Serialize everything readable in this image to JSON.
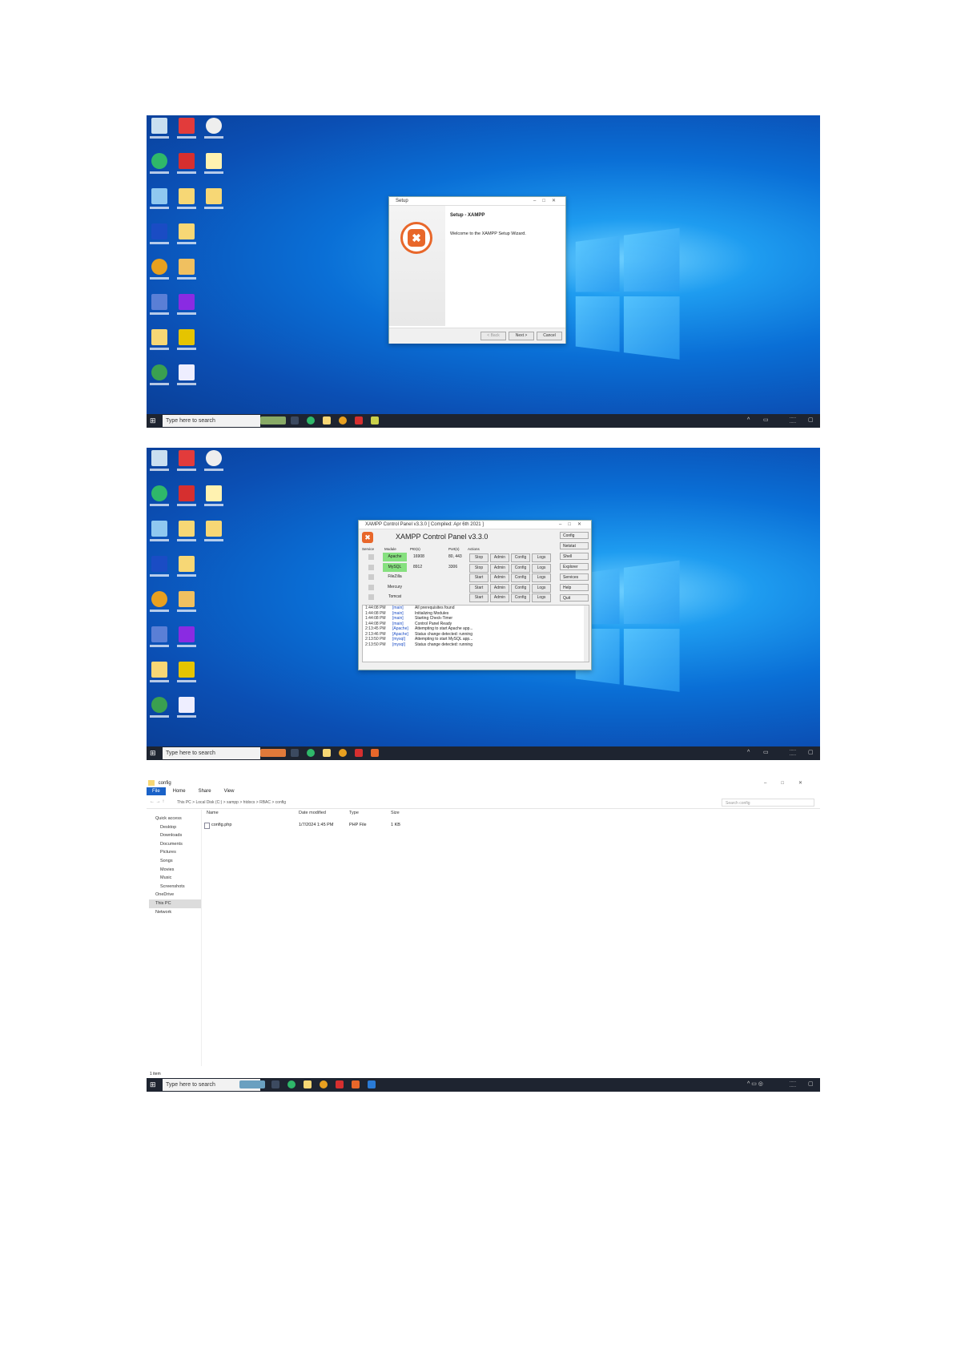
{
  "taskbar": {
    "search_placeholder": "Type here to search"
  },
  "shot1": {
    "setup": {
      "title": "Setup",
      "heading": "Setup - XAMPP",
      "welcome": "Welcome to the XAMPP Setup Wizard.",
      "buttons": {
        "back": "< Back",
        "next": "Next >",
        "cancel": "Cancel"
      }
    }
  },
  "shot2": {
    "panel": {
      "title": "XAMPP Control Panel v3.3.0  [ Compiled: Apr 6th 2021 ]",
      "heading": "XAMPP Control Panel v3.3.0",
      "col_headers": {
        "service": "Service",
        "module": "Module",
        "pid": "PID(s)",
        "port": "Port(s)",
        "actions": "Actions"
      },
      "modules": [
        {
          "name": "Apache",
          "pid": "16908",
          "port": "80, 443",
          "action1": "Stop",
          "status": "#86e07f"
        },
        {
          "name": "MySQL",
          "pid": "8912",
          "port": "3306",
          "action1": "Stop",
          "status": "#86e07f"
        },
        {
          "name": "FileZilla",
          "pid": "",
          "port": "",
          "action1": "Start",
          "status": ""
        },
        {
          "name": "Mercury",
          "pid": "",
          "port": "",
          "action1": "Start",
          "status": ""
        },
        {
          "name": "Tomcat",
          "pid": "",
          "port": "",
          "action1": "Start",
          "status": ""
        }
      ],
      "action_labels": {
        "admin": "Admin",
        "config": "Config",
        "logs": "Logs"
      },
      "side_buttons": [
        "Config",
        "Netstat",
        "Shell",
        "Explorer",
        "Services",
        "Help",
        "Quit"
      ],
      "log": [
        {
          "time": "1:44:08 PM",
          "module": "[main]",
          "msg": "All prerequisites found"
        },
        {
          "time": "1:44:08 PM",
          "module": "[main]",
          "msg": "Initializing Modules"
        },
        {
          "time": "1:44:08 PM",
          "module": "[main]",
          "msg": "Starting Check-Timer"
        },
        {
          "time": "1:44:08 PM",
          "module": "[main]",
          "msg": "Control Panel Ready"
        },
        {
          "time": "2:13:45 PM",
          "module": "[Apache]",
          "msg": "Attempting to start Apache app..."
        },
        {
          "time": "2:13:46 PM",
          "module": "[Apache]",
          "msg": "Status change detected: running"
        },
        {
          "time": "2:13:50 PM",
          "module": "[mysql]",
          "msg": "Attempting to start MySQL app..."
        },
        {
          "time": "2:13:50 PM",
          "module": "[mysql]",
          "msg": "Status change detected: running"
        }
      ]
    }
  },
  "shot3": {
    "explorer": {
      "title": "config",
      "tabs": [
        "File",
        "Home",
        "Share",
        "View"
      ],
      "breadcrumb": "This PC  >  Local Disk (C:)  >  xampp  >  htdocs  >  RBAC  >  config",
      "search_placeholder": "Search config",
      "columns": [
        "Name",
        "Date modified",
        "Type",
        "Size"
      ],
      "files": [
        {
          "name": "config.php",
          "date": "1/7/2024 1:45 PM",
          "type": "PHP File",
          "size": "1 KB"
        }
      ],
      "nav": [
        "Quick access",
        "Desktop",
        "Downloads",
        "Documents",
        "Pictures",
        "Songs",
        "Movies",
        "Music",
        "Screenshots",
        "OneDrive",
        "This PC",
        "Network"
      ],
      "status": "1 item"
    }
  }
}
